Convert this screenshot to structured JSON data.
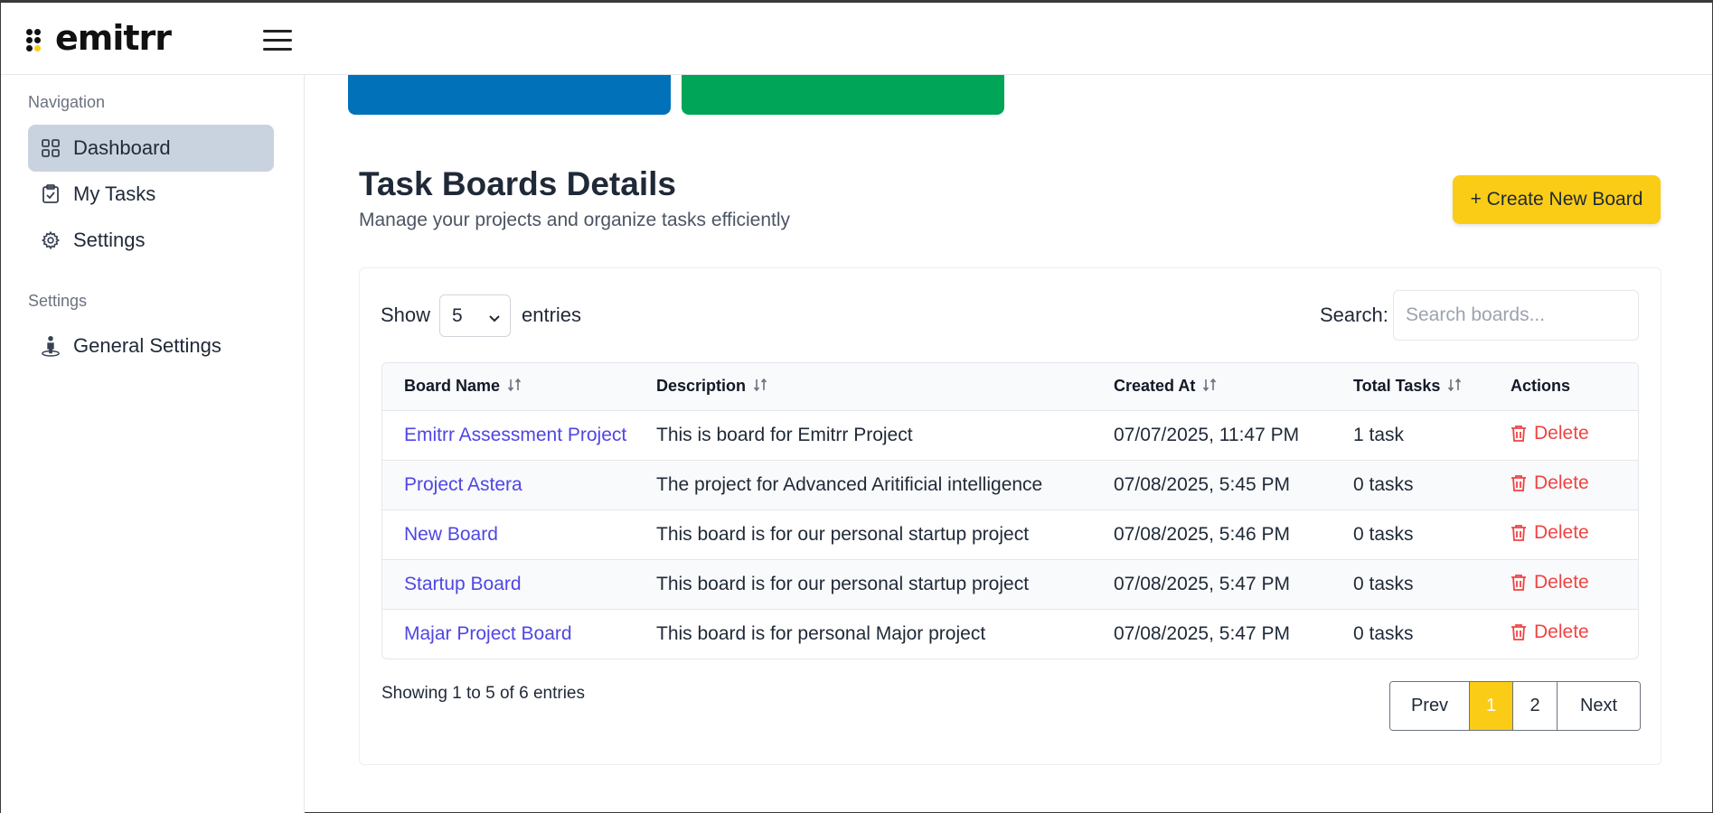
{
  "app": {
    "logo_text": "emitrr"
  },
  "sidebar": {
    "nav_section_title": "Navigation",
    "items": [
      {
        "label": "Dashboard",
        "icon": "grid-icon",
        "active": true
      },
      {
        "label": "My Tasks",
        "icon": "clipboard-check-icon",
        "active": false
      },
      {
        "label": "Settings",
        "icon": "gear-icon",
        "active": false
      }
    ],
    "settings_section_title": "Settings",
    "settings_items": [
      {
        "label": "General Settings",
        "icon": "user-pin-icon"
      }
    ]
  },
  "colors": {
    "card_blue": "#0171b9",
    "card_green": "#00a557",
    "accent": "#facc15",
    "link": "#4f46e5",
    "danger": "#ef4444"
  },
  "main": {
    "title": "Task Boards Details",
    "subtitle": "Manage your projects and organize tasks efficiently",
    "create_button": "+ Create New Board",
    "show_label": "Show",
    "entries_value": "5",
    "entries_label": "entries",
    "search_label": "Search:",
    "search_placeholder": "Search boards...",
    "table": {
      "headers": [
        "Board Name",
        "Description",
        "Created At",
        "Total Tasks",
        "Actions"
      ],
      "rows": [
        {
          "name": "Emitrr Assessment Project",
          "description": "This is board for Emitrr Project",
          "created": "07/07/2025, 11:47 PM",
          "tasks": "1 task",
          "action": "Delete"
        },
        {
          "name": "Project Astera",
          "description": "The project for Advanced Aritificial intelligence",
          "created": "07/08/2025, 5:45 PM",
          "tasks": "0 tasks",
          "action": "Delete"
        },
        {
          "name": "New Board",
          "description": "This board is for our personal startup project",
          "created": "07/08/2025, 5:46 PM",
          "tasks": "0 tasks",
          "action": "Delete"
        },
        {
          "name": "Startup Board",
          "description": "This board is for our personal startup project",
          "created": "07/08/2025, 5:47 PM",
          "tasks": "0 tasks",
          "action": "Delete"
        },
        {
          "name": "Majar Project Board",
          "description": "This board is for personal Major project",
          "created": "07/08/2025, 5:47 PM",
          "tasks": "0 tasks",
          "action": "Delete"
        }
      ]
    },
    "showing_text": "Showing 1 to 5 of 6 entries",
    "pagination": {
      "prev": "Prev",
      "page1": "1",
      "page2": "2",
      "next": "Next"
    }
  }
}
